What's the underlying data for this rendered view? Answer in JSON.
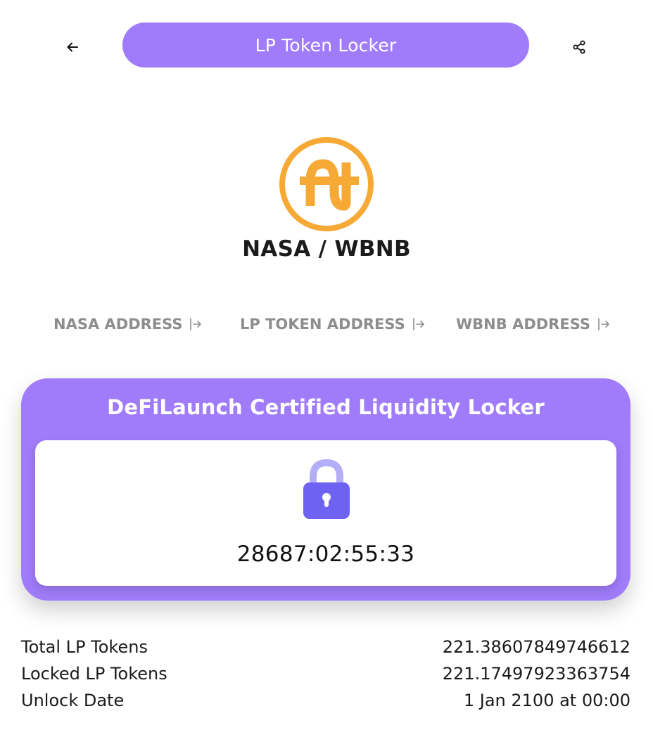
{
  "header": {
    "title": "LP Token Locker",
    "back_icon": "arrow-left-icon",
    "share_icon": "share-icon"
  },
  "token": {
    "logo_icon": "nasa-token-logo",
    "pair_name": "NASA / WBNB"
  },
  "addresses": [
    {
      "label": "NASA ADDRESS",
      "icon": "external-link-icon"
    },
    {
      "label": "LP TOKEN ADDRESS",
      "icon": "external-link-icon"
    },
    {
      "label": "WBNB ADDRESS",
      "icon": "external-link-icon"
    }
  ],
  "locker": {
    "title": "DeFiLaunch Certified Liquidity Locker",
    "lock_icon": "padlock-icon",
    "countdown": "28687:02:55:33"
  },
  "stats": [
    {
      "label": "Total LP Tokens",
      "value": "221.38607849746612"
    },
    {
      "label": "Locked LP Tokens",
      "value": "221.17497923363754"
    },
    {
      "label": "Unlock Date",
      "value": "1 Jan 2100 at 00:00"
    }
  ],
  "colors": {
    "accent": "#a07cfa",
    "logo_orange": "#f7a935",
    "lock_body": "#6e62f2",
    "lock_shackle": "#b4aef9",
    "muted_text": "#8d8d8d"
  }
}
